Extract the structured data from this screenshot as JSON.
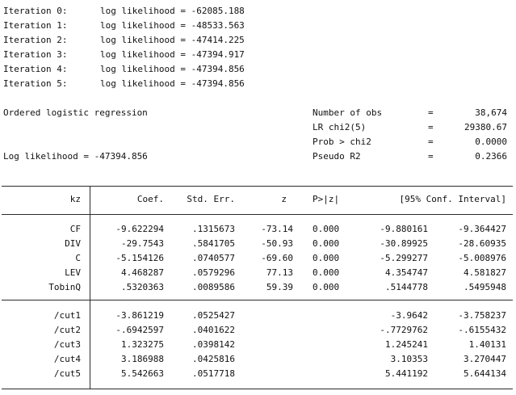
{
  "iterations": [
    {
      "label": "Iteration 0:",
      "text": "log likelihood = -62085.188"
    },
    {
      "label": "Iteration 1:",
      "text": "log likelihood = -48533.563"
    },
    {
      "label": "Iteration 2:",
      "text": "log likelihood = -47414.225"
    },
    {
      "label": "Iteration 3:",
      "text": "log likelihood = -47394.917"
    },
    {
      "label": "Iteration 4:",
      "text": "log likelihood = -47394.856"
    },
    {
      "label": "Iteration 5:",
      "text": "log likelihood = -47394.856"
    }
  ],
  "model": {
    "title": "Ordered logistic regression",
    "log_likelihood": "Log likelihood = -47394.856",
    "stats": [
      {
        "label": "Number of obs",
        "eq": "=",
        "value": "38,674"
      },
      {
        "label": "LR chi2(5)",
        "eq": "=",
        "value": "29380.67"
      },
      {
        "label": "Prob > chi2",
        "eq": "=",
        "value": "0.0000"
      },
      {
        "label": "Pseudo R2",
        "eq": "=",
        "value": "0.2366"
      }
    ]
  },
  "table": {
    "headers": {
      "var": "kz",
      "coef": "Coef.",
      "se": "Std. Err.",
      "z": "z",
      "p": "P>|z|",
      "ci": "[95% Conf. Interval]"
    },
    "rows": [
      {
        "var": "CF",
        "coef": "-9.622294",
        "se": ".1315673",
        "z": "-73.14",
        "p": "0.000",
        "lo": "-9.880161",
        "hi": "-9.364427"
      },
      {
        "var": "DIV",
        "coef": "-29.7543",
        "se": ".5841705",
        "z": "-50.93",
        "p": "0.000",
        "lo": "-30.89925",
        "hi": "-28.60935"
      },
      {
        "var": "C",
        "coef": "-5.154126",
        "se": ".0740577",
        "z": "-69.60",
        "p": "0.000",
        "lo": "-5.299277",
        "hi": "-5.008976"
      },
      {
        "var": "LEV",
        "coef": "4.468287",
        "se": ".0579296",
        "z": "77.13",
        "p": "0.000",
        "lo": "4.354747",
        "hi": "4.581827"
      },
      {
        "var": "TobinQ",
        "coef": ".5320363",
        "se": ".0089586",
        "z": "59.39",
        "p": "0.000",
        "lo": ".5144778",
        "hi": ".5495948"
      }
    ],
    "cuts": [
      {
        "var": "/cut1",
        "coef": "-3.861219",
        "se": ".0525427",
        "lo": "-3.9642",
        "hi": "-3.758237"
      },
      {
        "var": "/cut2",
        "coef": "-.6942597",
        "se": ".0401622",
        "lo": "-.7729762",
        "hi": "-.6155432"
      },
      {
        "var": "/cut3",
        "coef": "1.323275",
        "se": ".0398142",
        "lo": "1.245241",
        "hi": "1.40131"
      },
      {
        "var": "/cut4",
        "coef": "3.186988",
        "se": ".0425816",
        "lo": "3.10353",
        "hi": "3.270447"
      },
      {
        "var": "/cut5",
        "coef": "5.542663",
        "se": ".0517718",
        "lo": "5.441192",
        "hi": "5.644134"
      }
    ]
  }
}
